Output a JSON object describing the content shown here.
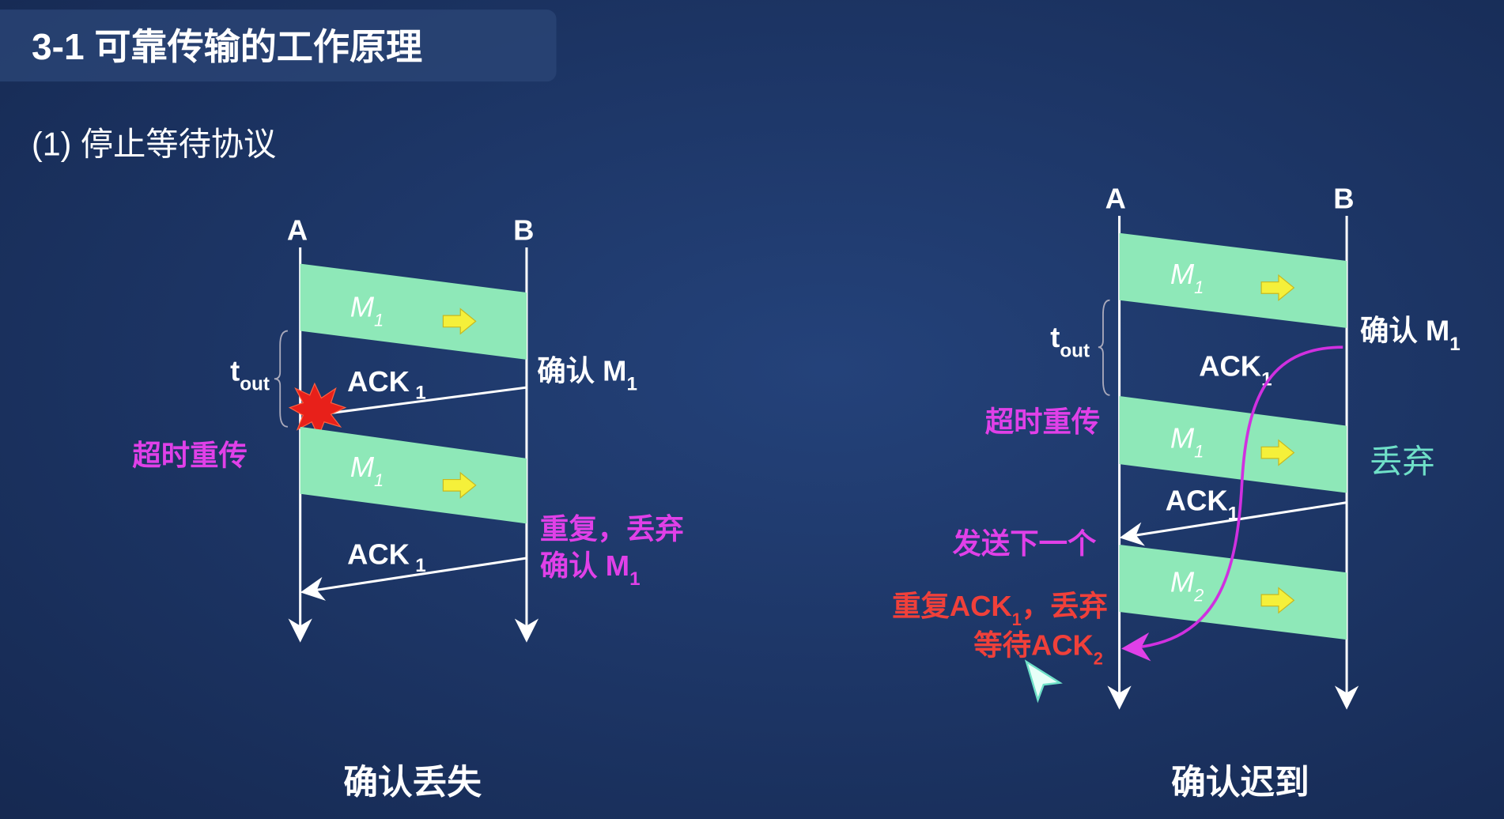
{
  "header": {
    "title": "3-1 可靠传输的工作原理",
    "subtitle": "(1) 停止等待协议"
  },
  "colors": {
    "background": "#1b3160",
    "band": "#8ee8b8",
    "arrow": "#f5f03a",
    "magenta": "#e040e8",
    "red": "#f0403a",
    "teal": "#6fe0c8"
  },
  "left": {
    "sender": "A",
    "receiver": "B",
    "frame_main": "M",
    "frame_sub": "1",
    "ack_main": "ACK",
    "ack_sub": "1",
    "timeout_main": "t",
    "timeout_sub": "out",
    "confirm_main": "确认 M",
    "confirm_sub": "1",
    "retransmit": "超时重传",
    "duplicate": "重复，丢弃",
    "caption": "确认丢失"
  },
  "right": {
    "sender": "A",
    "receiver": "B",
    "frame_main": "M",
    "frame1_sub": "1",
    "frame2_sub": "2",
    "ack_main": "ACK",
    "ack_sub": "1",
    "timeout_main": "t",
    "timeout_sub": "out",
    "confirm_main": "确认 M",
    "confirm_sub": "1",
    "retransmit": "超时重传",
    "discard": "丢弃",
    "send_next": "发送下一个",
    "dup_main": "重复ACK",
    "dup_sub": "1",
    "dup_tail": "，丢弃",
    "wait_main": "等待ACK",
    "wait_sub": "2",
    "caption": "确认迟到"
  }
}
